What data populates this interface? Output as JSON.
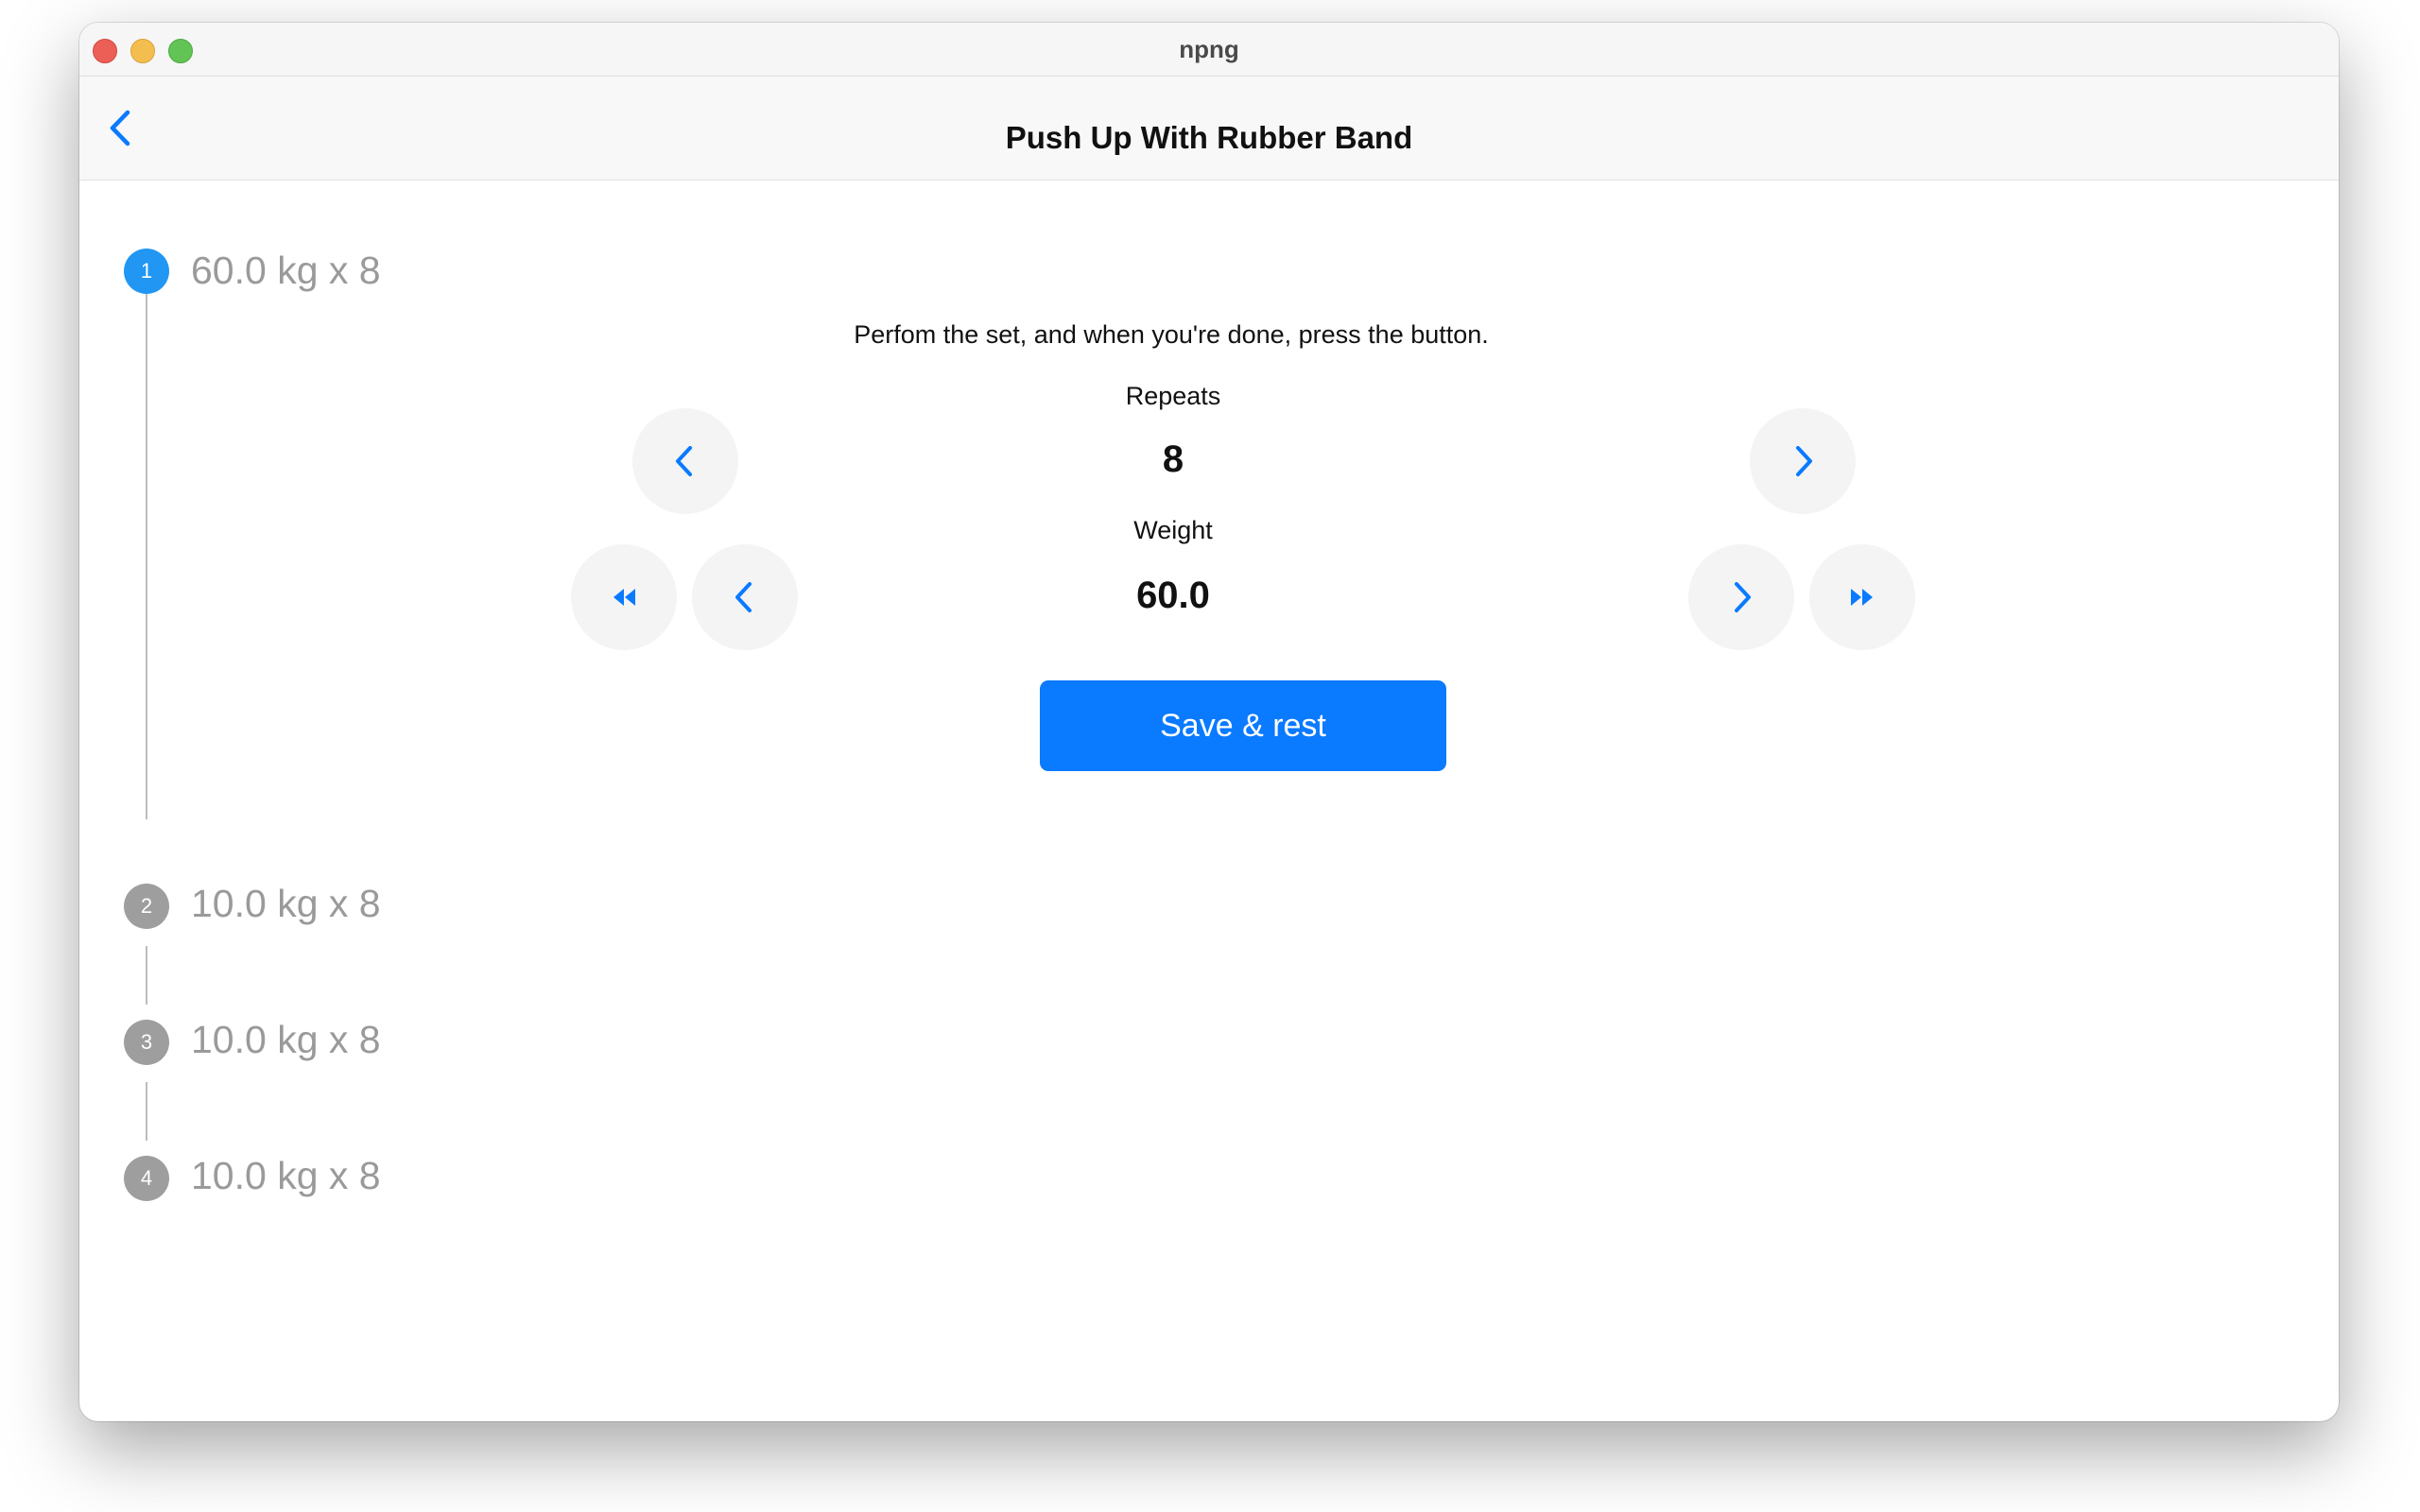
{
  "window": {
    "title": "npng"
  },
  "navbar": {
    "title": "Push Up With Rubber Band"
  },
  "steps": [
    {
      "number": "1",
      "label": "60.0 kg x 8",
      "active": true
    },
    {
      "number": "2",
      "label": "10.0 kg x 8",
      "active": false
    },
    {
      "number": "3",
      "label": "10.0 kg x 8",
      "active": false
    },
    {
      "number": "4",
      "label": "10.0 kg x 8",
      "active": false
    }
  ],
  "set_form": {
    "instruction": "Perfom the set, and when you're done, press the button.",
    "repeats_label": "Repeats",
    "repeats_value": "8",
    "weight_label": "Weight",
    "weight_value": "60.0",
    "save_label": "Save & rest"
  },
  "colors": {
    "accent": "#0a7aff",
    "step_active": "#2196f3",
    "step_inactive": "#9e9e9e",
    "button_bg": "#f4f4f4"
  },
  "icons": {
    "back": "chevron-left-icon",
    "decrement": "chevron-left-icon",
    "increment": "chevron-right-icon",
    "fast_decrement": "rewind-icon",
    "fast_increment": "fast-forward-icon"
  }
}
